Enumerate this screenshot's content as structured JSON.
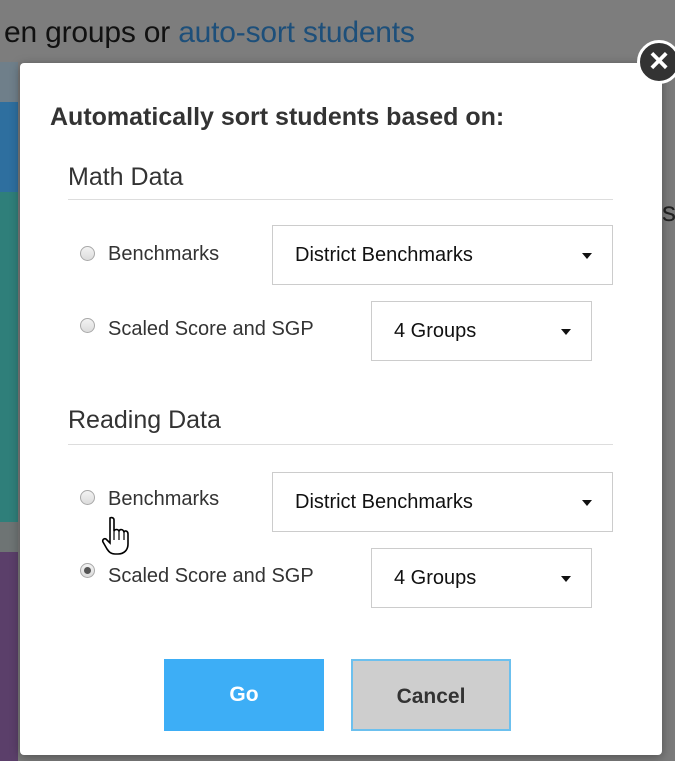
{
  "background": {
    "header_prefix": "en groups or ",
    "header_link": "auto-sort students",
    "right_letter": "s"
  },
  "modal": {
    "title": "Automatically sort students based on:",
    "close_icon": "close-icon",
    "sections": [
      {
        "heading": "Math Data",
        "options": [
          {
            "label": "Benchmarks",
            "selected": false,
            "select_value": "District Benchmarks"
          },
          {
            "label": "Scaled Score and SGP",
            "selected": false,
            "select_value": "4 Groups"
          }
        ]
      },
      {
        "heading": "Reading Data",
        "options": [
          {
            "label": "Benchmarks",
            "selected": false,
            "select_value": "District Benchmarks"
          },
          {
            "label": "Scaled Score and SGP",
            "selected": true,
            "select_value": "4 Groups"
          }
        ]
      }
    ],
    "buttons": {
      "go": "Go",
      "cancel": "Cancel"
    }
  },
  "colors": {
    "overlay": "#7b7b7b",
    "go_button": "#3daef6",
    "cancel_button": "#cecece",
    "link": "#1d4f7a"
  }
}
